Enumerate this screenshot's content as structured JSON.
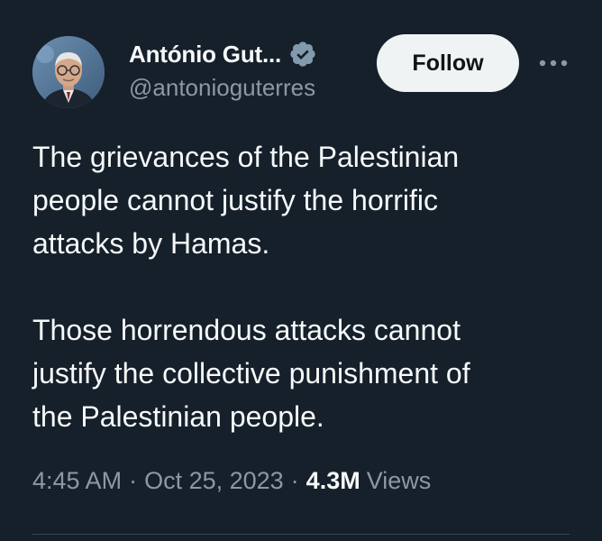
{
  "author": {
    "display_name": "António Gut...",
    "handle": "@antonioguterres",
    "avatar_icon": "profile-photo",
    "verified_icon": "verified-badge-icon"
  },
  "actions": {
    "follow_label": "Follow",
    "more_icon": "more-options-icon"
  },
  "tweet": {
    "paragraphs": [
      "The grievances of the Palestinian\npeople cannot justify the horrific\nattacks by Hamas.",
      "Those horrendous attacks cannot\njustify the collective punishment of\nthe Palestinian people."
    ],
    "time": "4:45 AM",
    "separator": "·",
    "date": "Oct 25, 2023",
    "views_count": "4.3M",
    "views_label": "Views"
  },
  "colors": {
    "background": "#15202b",
    "primary_text": "#f7f9f9",
    "secondary_text": "#8b98a5",
    "follow_button_bg": "#eff3f4",
    "verified_badge": "#829aab"
  }
}
